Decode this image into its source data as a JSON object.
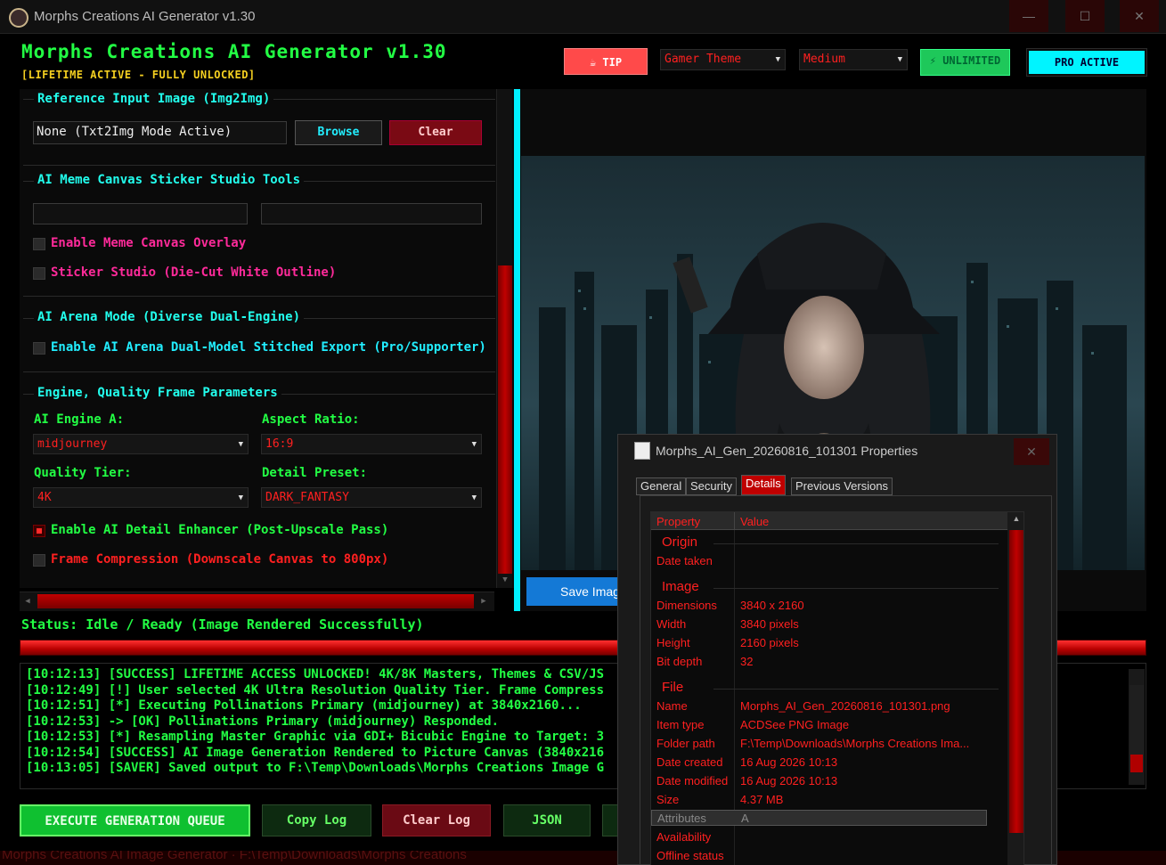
{
  "window": {
    "title": "Morphs Creations AI Generator v1.30",
    "controls": {
      "minimize": "—",
      "maximize": "☐",
      "close": "✕"
    }
  },
  "header": {
    "title": "Morphs Creations AI Generator v1.30",
    "subtitle": "[LIFETIME ACTIVE - FULLY UNLOCKED]",
    "tip_label": "☕ TIP",
    "theme_value": "Gamer Theme",
    "size_value": "Medium",
    "unlimited_label": "⚡ UNLIMITED",
    "pro_label": "PRO ACTIVE"
  },
  "reference": {
    "title": "Reference Input Image (Img2Img)",
    "path_value": "None (Txt2Img Mode Active)",
    "browse_label": "Browse",
    "clear_label": "Clear"
  },
  "meme": {
    "title": "AI Meme Canvas Sticker Studio Tools",
    "field1_value": "",
    "field2_value": "",
    "overlay_label": "Enable Meme Canvas Overlay",
    "sticker_label": "Sticker Studio (Die-Cut White Outline)"
  },
  "arena": {
    "title": "AI Arena Mode (Diverse Dual-Engine)",
    "export_label": "Enable AI Arena Dual-Model Stitched Export (Pro/Supporter)"
  },
  "engine": {
    "title": "Engine, Quality Frame Parameters",
    "engine_label": "AI Engine A:",
    "engine_value": "midjourney",
    "aspect_label": "Aspect Ratio:",
    "aspect_value": "16:9",
    "quality_label": "Quality Tier:",
    "quality_value": "4K",
    "detail_label": "Detail Preset:",
    "detail_value": "DARK_FANTASY",
    "enhancer_label": "Enable AI Detail Enhancer (Post-Upscale Pass)",
    "enhancer_checked": true,
    "compression_label": "Frame Compression (Downscale Canvas to 800px)",
    "compression_checked": false
  },
  "preview": {
    "save_label": "Save Image"
  },
  "status": {
    "text": "Status: Idle / Ready (Image Rendered Successfully)",
    "progress": 1.0
  },
  "log": [
    "[10:12:13] [SUCCESS] LIFETIME ACCESS UNLOCKED! 4K/8K Masters, Themes & CSV/JS",
    "[10:12:49] [!] User selected 4K Ultra Resolution Quality Tier. Frame Compress",
    "[10:12:51] [*] Executing Pollinations Primary (midjourney) at 3840x2160...",
    "[10:12:53]  -> [OK] Pollinations Primary (midjourney) Responded.",
    "[10:12:53] [*] Resampling Master Graphic via GDI+ Bicubic Engine to Target: 3",
    "[10:12:54] [SUCCESS] AI Image Generation Rendered to Picture Canvas (3840x216",
    "[10:13:05] [SAVER] Saved output to F:\\Temp\\Downloads\\Morphs Creations Image G"
  ],
  "actions": {
    "execute_label": "EXECUTE GENERATION QUEUE",
    "copy_label": "Copy Log",
    "clear_label": "Clear Log",
    "json_label": "JSON"
  },
  "taskbar_text": "Morphs Creations AI Image Generator  ·   F:\\Temp\\Downloads\\Morphs Creations",
  "properties": {
    "title": "Morphs_AI_Gen_20260816_101301 Properties",
    "tabs": [
      "General",
      "Security",
      "Details",
      "Previous Versions"
    ],
    "active_tab": "Details",
    "col_property": "Property",
    "col_value": "Value",
    "sections": {
      "origin": "Origin",
      "image": "Image",
      "file": "File"
    },
    "rows": {
      "date_taken": {
        "k": "Date taken",
        "v": ""
      },
      "dimensions": {
        "k": "Dimensions",
        "v": "3840 x 2160"
      },
      "width": {
        "k": "Width",
        "v": "3840 pixels"
      },
      "height": {
        "k": "Height",
        "v": "2160 pixels"
      },
      "bit_depth": {
        "k": "Bit depth",
        "v": "32"
      },
      "name": {
        "k": "Name",
        "v": "Morphs_AI_Gen_20260816_101301.png"
      },
      "item_type": {
        "k": "Item type",
        "v": "ACDSee PNG Image"
      },
      "folder_path": {
        "k": "Folder path",
        "v": "F:\\Temp\\Downloads\\Morphs Creations Ima..."
      },
      "date_created": {
        "k": "Date created",
        "v": "16 Aug 2026 10:13"
      },
      "date_modified": {
        "k": "Date modified",
        "v": "16 Aug 2026 10:13"
      },
      "size": {
        "k": "Size",
        "v": "4.37 MB"
      },
      "attributes": {
        "k": "Attributes",
        "v": "A"
      },
      "availability": {
        "k": "Availability",
        "v": ""
      },
      "offline_status": {
        "k": "Offline status",
        "v": ""
      }
    }
  },
  "colors": {
    "accent_green": "#22ff44",
    "accent_cyan": "#00f0ff",
    "accent_red": "#ff2020",
    "accent_pink": "#ff2a9a",
    "accent_yellow": "#f5d020"
  }
}
